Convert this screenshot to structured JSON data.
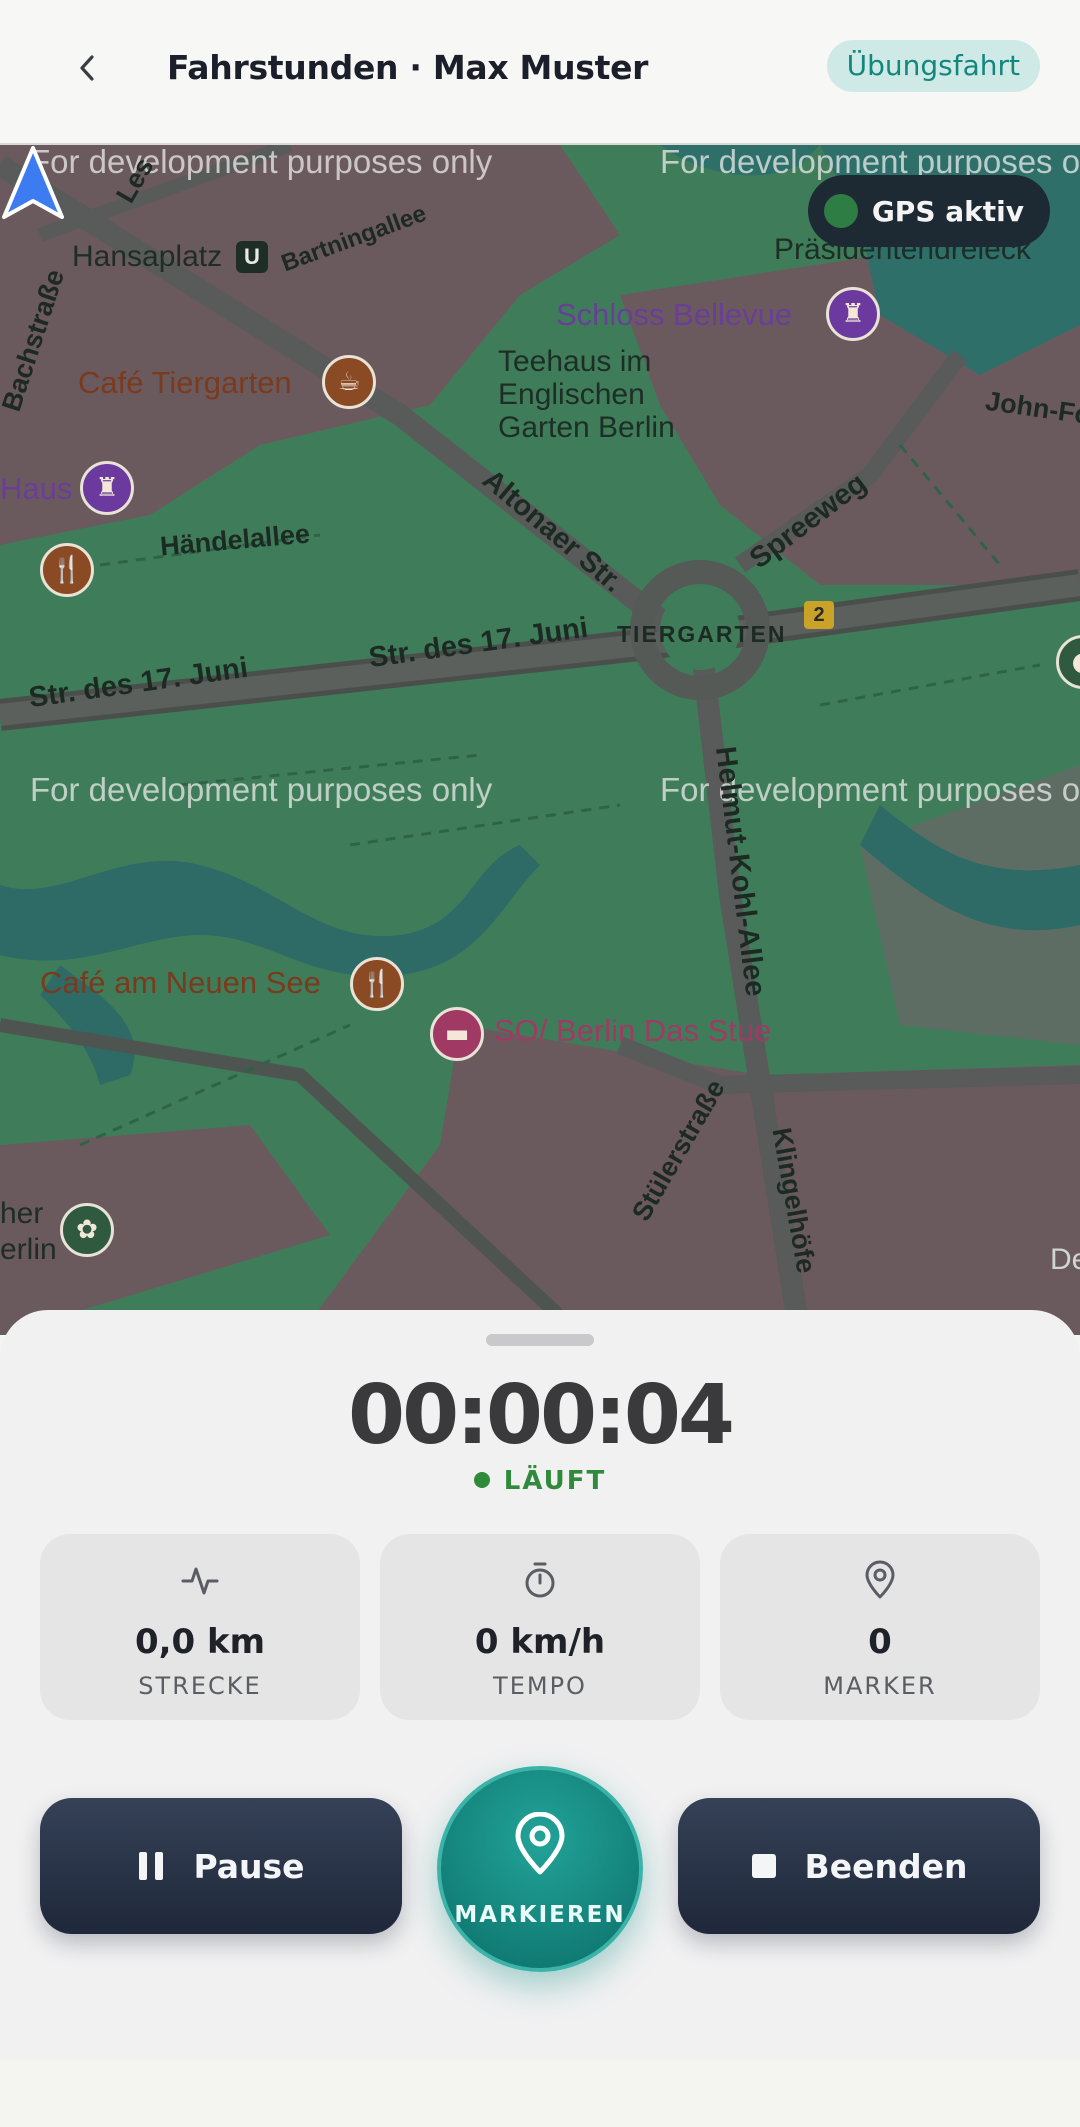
{
  "header": {
    "title": "Fahrstunden · Max Muster",
    "mode_badge": "Übungsfahrt",
    "back_icon": "chevron-left-icon"
  },
  "map": {
    "gps_status": "GPS aktiv",
    "watermark": "For development purposes only",
    "labels": {
      "hansaplatz": "Hansaplatz",
      "ubahn": "U",
      "bartningallee": "Bartningallee",
      "lessing": "Les",
      "bachstrasse": "Bachstraße",
      "praesidentendreieck": "Präsidentendreieck",
      "schloss_bellevue": "Schloss Bellevue",
      "cafe_tiergarten": "Café Tiergarten",
      "teehaus": "Teehaus im Englischen Garten Berlin",
      "john_fo": "John-Fo",
      "haus": "Haus",
      "haendelallee": "Händelallee",
      "altonaer": "Altonaer Str.",
      "spreeweg": "Spreeweg",
      "tiergarten": "TIERGARTEN",
      "route_2": "2",
      "str17_left": "Str. des 17. Juni",
      "str17_center": "Str. des 17. Juni",
      "helmut_kohl": "Helmut-Kohl-Allee",
      "cafe_neuen_see": "Café am Neuen See",
      "so_berlin": "SO/ Berlin Das Stue",
      "stuelerstrasse": "Stülerstraße",
      "klingelhoefer": "Klingelhöfe",
      "her": "her",
      "erlin": "erlin",
      "de": "De"
    }
  },
  "session": {
    "timer": "00:00:04",
    "status": "LÄUFT",
    "stats": [
      {
        "value": "0,0 km",
        "label": "STRECKE",
        "icon": "activity-icon"
      },
      {
        "value": "0 km/h",
        "label": "TEMPO",
        "icon": "stopwatch-icon"
      },
      {
        "value": "0",
        "label": "MARKER",
        "icon": "map-pin-icon"
      }
    ]
  },
  "actions": {
    "pause_label": "Pause",
    "mark_label": "MARKIEREN",
    "end_label": "Beenden"
  },
  "colors": {
    "accent": "#13877d",
    "map_park": "#3f7d5a",
    "running": "#2f8a3c",
    "button_dark": "#283247"
  }
}
